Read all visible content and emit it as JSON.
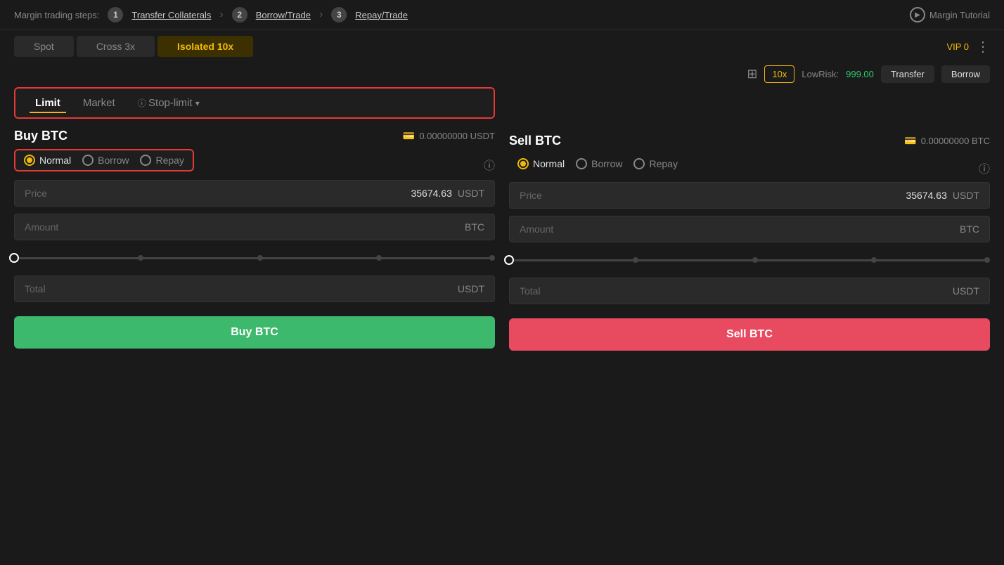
{
  "topbar": {
    "steps_label": "Margin trading steps:",
    "step1_num": "1",
    "step1_link": "Transfer Collaterals",
    "step2_num": "2",
    "step2_link": "Borrow/Trade",
    "step3_num": "3",
    "step3_link": "Repay/Trade",
    "tutorial_label": "Margin Tutorial"
  },
  "tabs": {
    "spot": "Spot",
    "cross": "Cross 3x",
    "isolated": "Isolated",
    "isolated_mult": "10x"
  },
  "vip": {
    "label": "VIP 0"
  },
  "toolbar": {
    "leverage": "10x",
    "lowrisk_label": "LowRisk:",
    "lowrisk_value": "999.00",
    "transfer_label": "Transfer",
    "borrow_label": "Borrow"
  },
  "order_types": {
    "limit": "Limit",
    "market": "Market",
    "stop_limit": "Stop-limit"
  },
  "buy_panel": {
    "title": "Buy BTC",
    "balance": "0.00000000 USDT",
    "radio_normal": "Normal",
    "radio_borrow": "Borrow",
    "radio_repay": "Repay",
    "price_label": "Price",
    "price_value": "35674.63",
    "price_unit": "USDT",
    "amount_label": "Amount",
    "amount_unit": "BTC",
    "total_label": "Total",
    "total_unit": "USDT",
    "buy_btn": "Buy BTC"
  },
  "sell_panel": {
    "title": "Sell BTC",
    "balance": "0.00000000 BTC",
    "radio_normal": "Normal",
    "radio_borrow": "Borrow",
    "radio_repay": "Repay",
    "price_label": "Price",
    "price_value": "35674.63",
    "price_unit": "USDT",
    "amount_label": "Amount",
    "amount_unit": "BTC",
    "total_label": "Total",
    "total_unit": "USDT",
    "sell_btn": "Sell BTC"
  }
}
